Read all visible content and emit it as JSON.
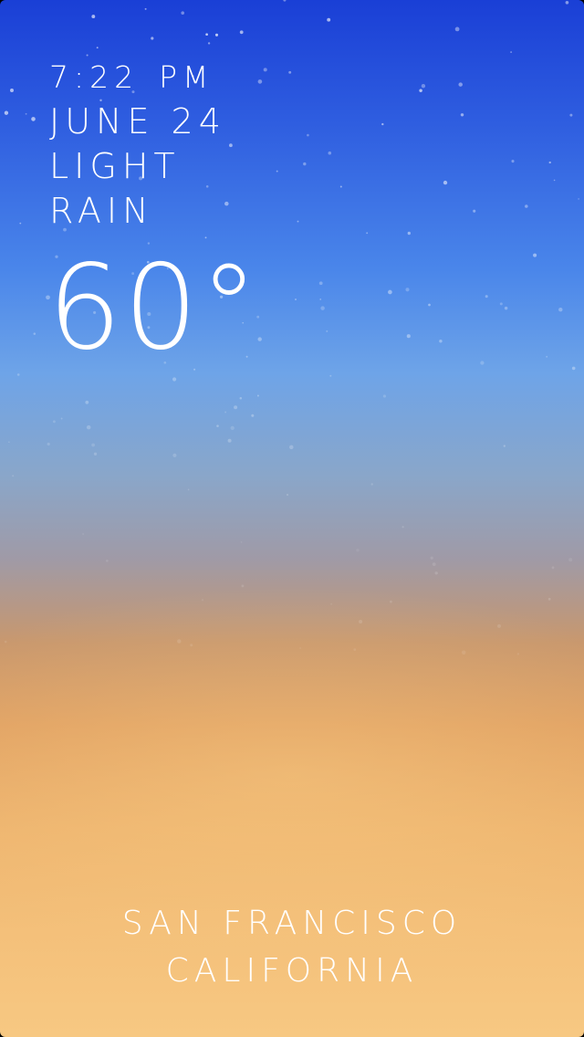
{
  "weather": {
    "time": "7:22",
    "meridiem": "PM",
    "date": "JUNE 24",
    "condition_line1": "LIGHT",
    "condition_line2": "RAIN",
    "temperature": "60°"
  },
  "location": {
    "city": "SAN FRANCISCO",
    "region": "CALIFORNIA"
  },
  "colors": {
    "sky_top": "#1a3fd6",
    "sky_mid": "#6ea4e8",
    "sky_bottom": "#f7c882",
    "text": "#ffffff"
  }
}
